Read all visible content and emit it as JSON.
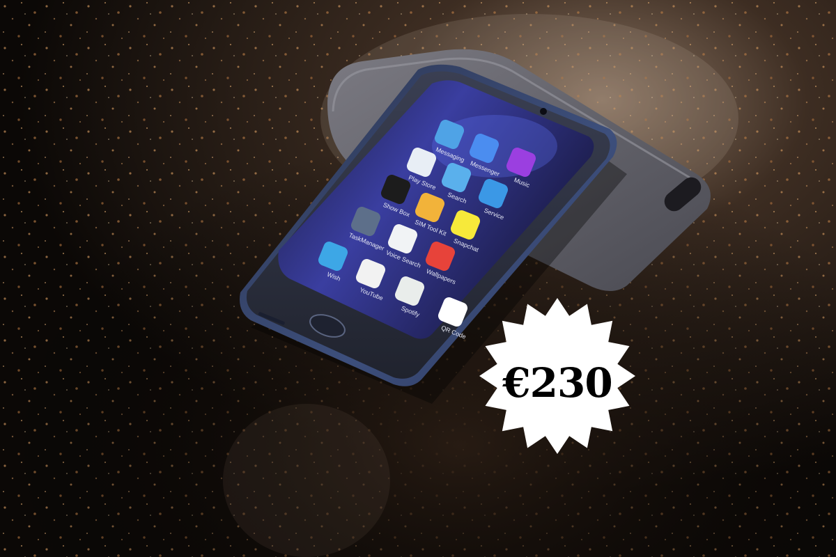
{
  "photo": {
    "price_badge": {
      "text": "€230",
      "bg": "#ffffff",
      "fg": "#000000"
    },
    "colors": {
      "surface": "#1a120c",
      "glitter": "#c8915a",
      "phone_frame": "#4a5d8c",
      "phone_glass": "#2b2f3c",
      "case": "#6b6a72",
      "screen_bg": "#2a2b6e"
    },
    "apps": [
      {
        "label": "Messaging",
        "icon": "messaging-icon",
        "color": "#4fa3e6"
      },
      {
        "label": "Messenger",
        "icon": "messenger-icon",
        "color": "#4b8df0"
      },
      {
        "label": "Music",
        "icon": "music-icon",
        "color": "#9b3fe0"
      },
      {
        "label": "Play Store",
        "icon": "play-store-icon",
        "color": "#e8eef5"
      },
      {
        "label": "Search",
        "icon": "search-icon",
        "color": "#5ab0ec"
      },
      {
        "label": "Service",
        "icon": "cloud-icon",
        "color": "#3b98e6"
      },
      {
        "label": "Show Box",
        "icon": "show-box-icon",
        "color": "#1c1c1c"
      },
      {
        "label": "SIM Tool Kit",
        "icon": "sim-icon",
        "color": "#f2b33a"
      },
      {
        "label": "Snapchat",
        "icon": "snapchat-icon",
        "color": "#f7e93a"
      },
      {
        "label": "TaskManager",
        "icon": "task-manager-icon",
        "color": "#5d6f8a"
      },
      {
        "label": "Voice Search",
        "icon": "mic-icon",
        "color": "#f1f3f5"
      },
      {
        "label": "Wallpapers",
        "icon": "wallpapers-icon",
        "color": "#e7433a"
      },
      {
        "label": "Wish",
        "icon": "wish-icon",
        "color": "#3da7e6"
      },
      {
        "label": "YouTube",
        "icon": "youtube-icon",
        "color": "#f2f2f2"
      },
      {
        "label": "Spotify",
        "icon": "spotify-icon",
        "color": "#e9edeb"
      },
      {
        "label": "QR Code",
        "icon": "qr-icon",
        "color": "#ffffff"
      }
    ]
  }
}
